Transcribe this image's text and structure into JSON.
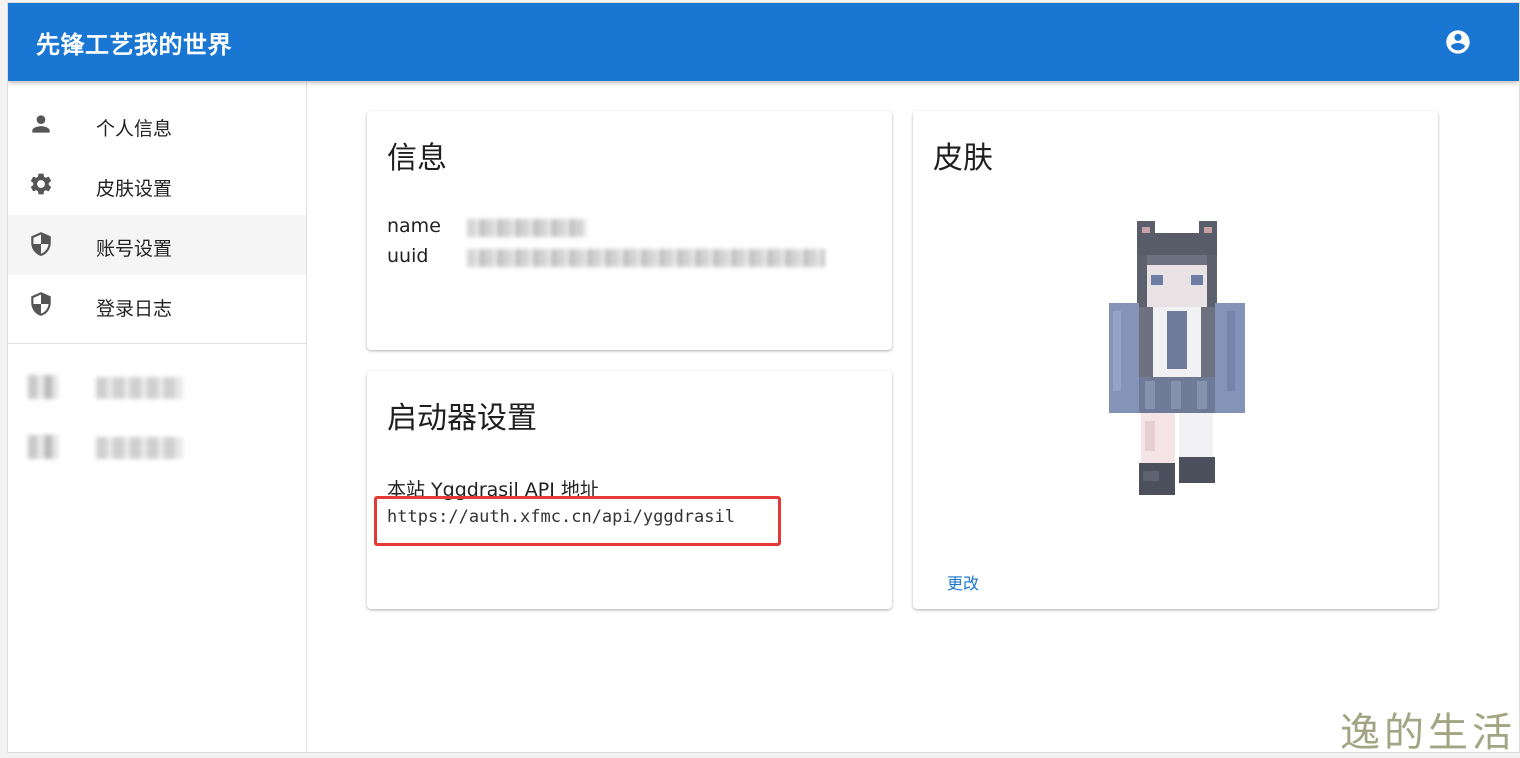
{
  "app": {
    "title": "先锋工艺我的世界"
  },
  "header": {
    "account_icon": "account-circle-icon"
  },
  "sidebar": {
    "items": [
      {
        "label": "个人信息",
        "icon": "person-icon",
        "active": false
      },
      {
        "label": "皮肤设置",
        "icon": "gear-icon",
        "active": false
      },
      {
        "label": "账号设置",
        "icon": "shield-icon",
        "active": true
      },
      {
        "label": "登录日志",
        "icon": "shield-icon",
        "active": false
      }
    ]
  },
  "info_card": {
    "title": "信息",
    "name_label": "name",
    "uuid_label": "uuid"
  },
  "launcher_card": {
    "title": "启动器设置",
    "api_label": "本站 Yggdrasil API 地址",
    "api_url": "https://auth.xfmc.cn/api/yggdrasil"
  },
  "skin_card": {
    "title": "皮肤",
    "change_label": "更改"
  },
  "watermark": "逸的生活",
  "colors": {
    "primary": "#1976d2",
    "highlight": "#e53935",
    "watermark": "#a2a583"
  }
}
